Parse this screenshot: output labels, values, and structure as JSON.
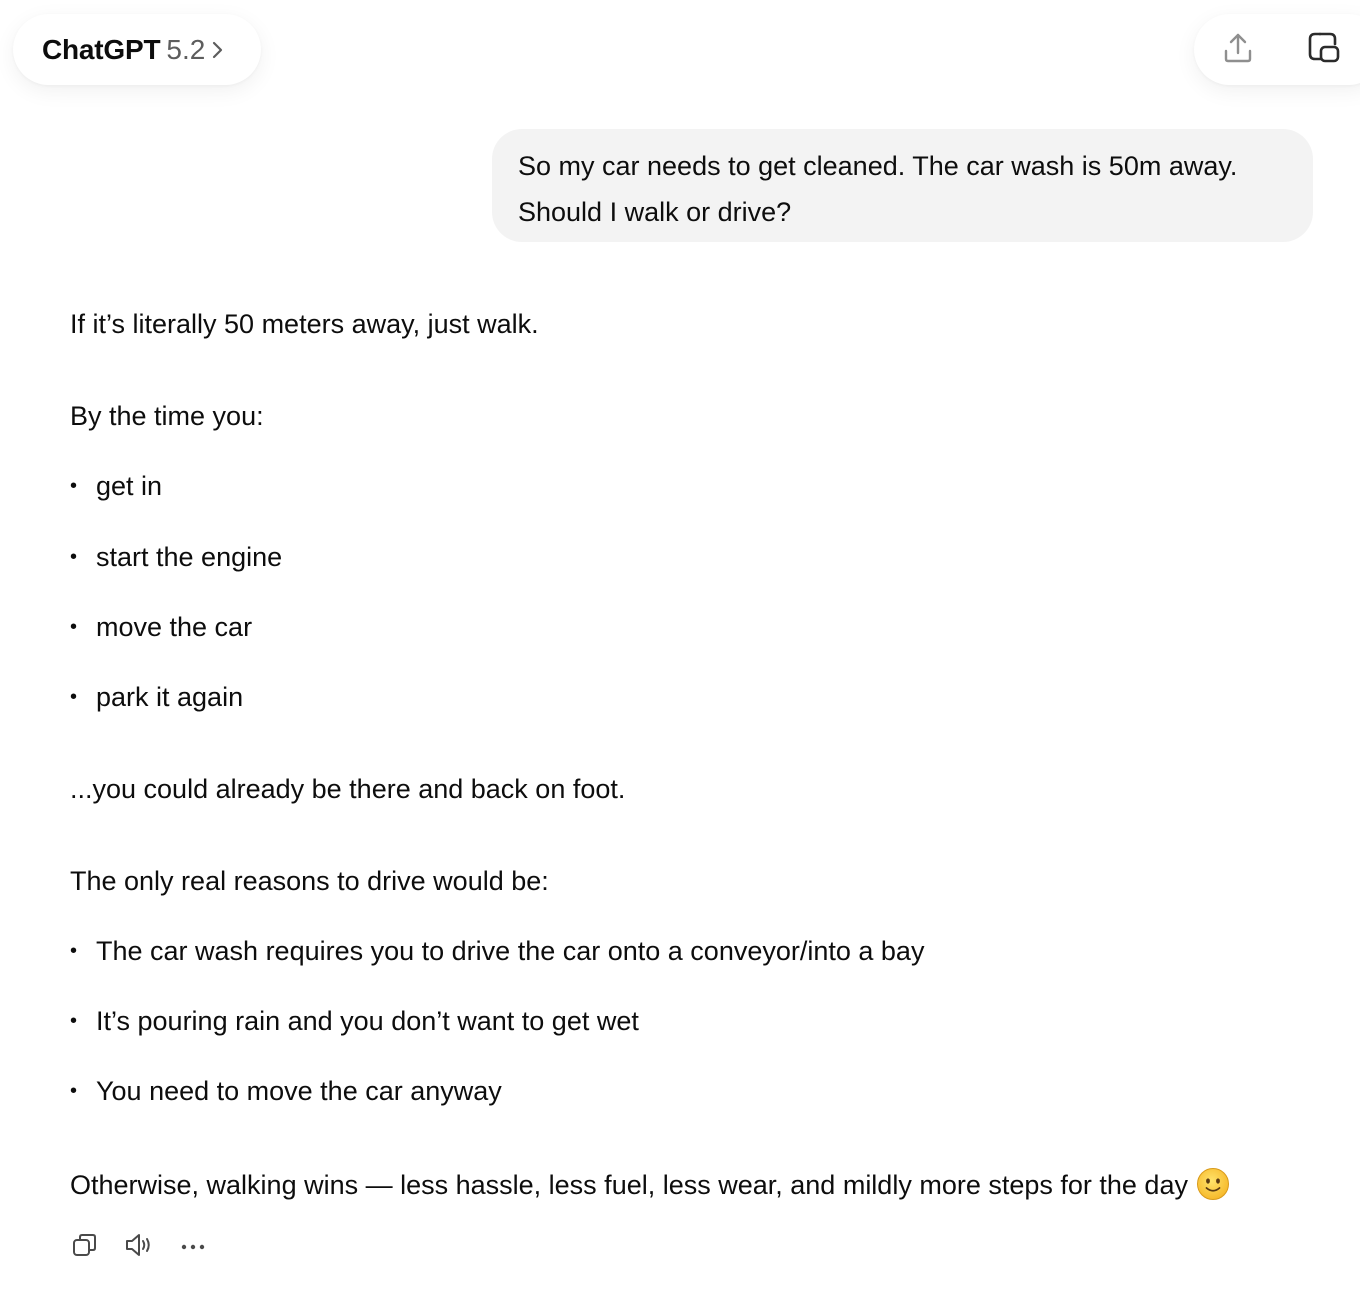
{
  "header": {
    "model_name": "ChatGPT",
    "model_version": "5.2",
    "chevron_icon": "chevron-right-icon",
    "share_icon": "share-upload-icon",
    "new_window_icon": "new-chat-window-icon"
  },
  "user_message": {
    "line1": "So my car needs to get cleaned. The car wash is 50m away.",
    "line2": "Should I walk or drive?"
  },
  "assistant": {
    "p1": "If it’s literally 50 meters away, just walk.",
    "p2": "By the time you:",
    "list1": [
      "get in",
      "start the engine",
      "move the car",
      "park it again"
    ],
    "p3": "...you could already be there and back on foot.",
    "p4": "The only real reasons to drive would be:",
    "list2": [
      "The car wash requires you to drive the car onto a conveyor/into a bay",
      "It’s pouring rain and you don’t want to get wet",
      "You need to move the car anyway"
    ],
    "p5": "Otherwise, walking wins — less hassle, less fuel, less wear, and mildly more steps for the day",
    "emoji": "slightly-smiling-face-emoji"
  },
  "actions": {
    "copy_icon": "copy-icon",
    "read_aloud_icon": "speaker-icon",
    "more_icon": "more-horizontal-icon"
  }
}
